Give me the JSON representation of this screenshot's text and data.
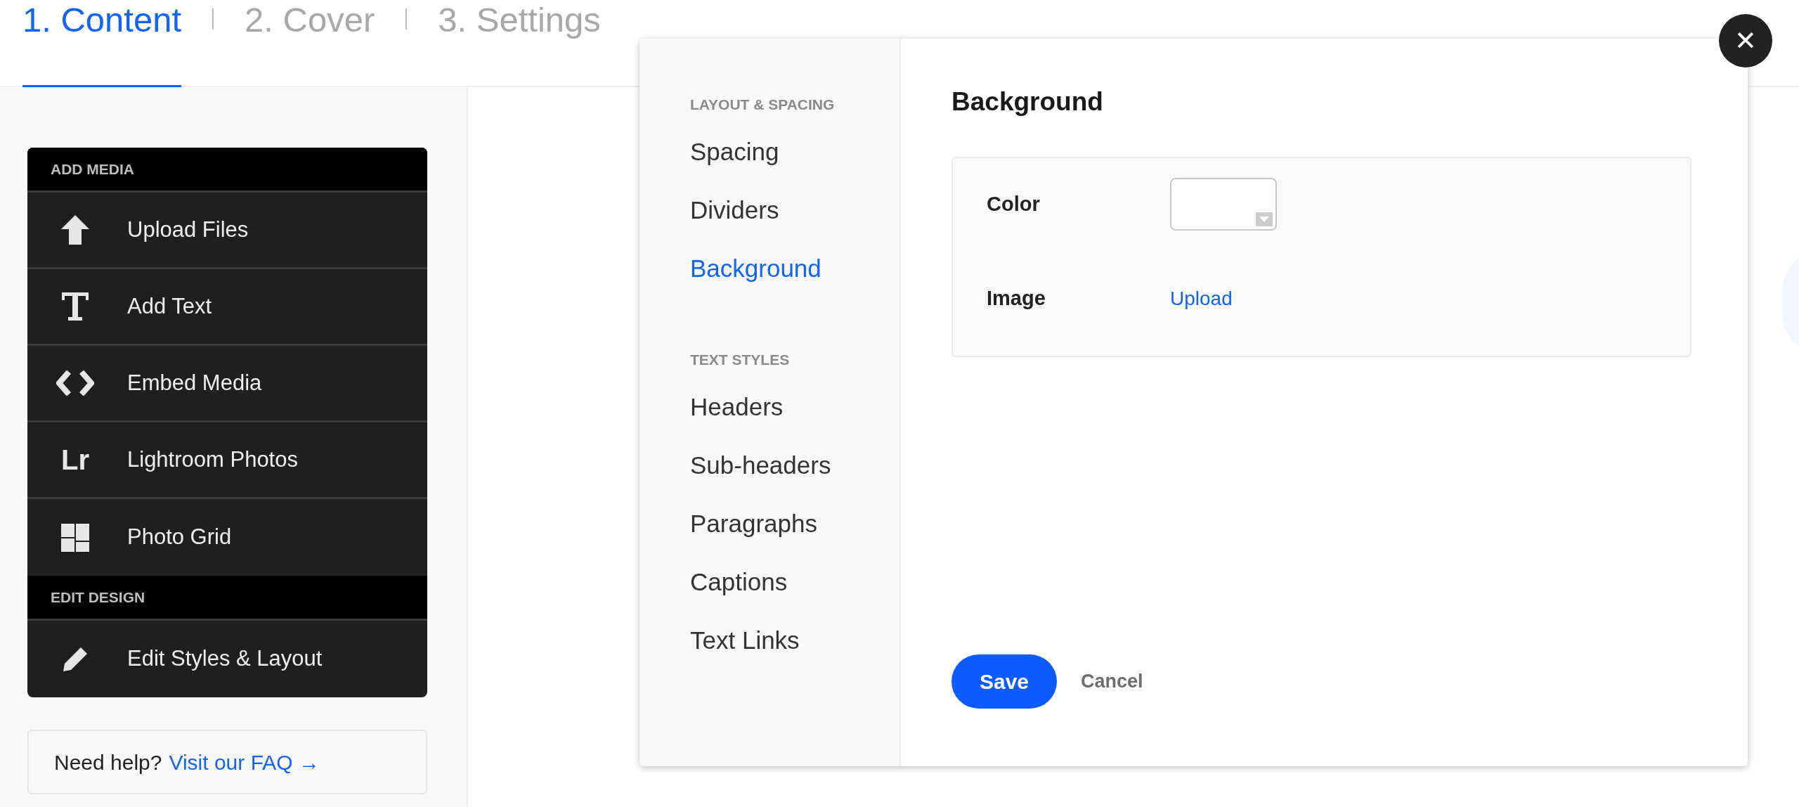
{
  "steps": [
    {
      "label": "1. Content",
      "selected": true
    },
    {
      "label": "2. Cover",
      "selected": false
    },
    {
      "label": "3. Settings",
      "selected": false
    }
  ],
  "sidebar": {
    "sections": [
      {
        "title": "ADD MEDIA",
        "items": [
          {
            "kind": "upload",
            "label": "Upload Files"
          },
          {
            "kind": "text",
            "label": "Add Text"
          },
          {
            "kind": "embed",
            "label": "Embed Media"
          },
          {
            "kind": "lightroom",
            "label": "Lightroom Photos",
            "icon_text": "Lr"
          },
          {
            "kind": "grid",
            "label": "Photo Grid"
          }
        ]
      },
      {
        "title": "EDIT DESIGN",
        "items": [
          {
            "kind": "pencil",
            "label": "Edit Styles & Layout"
          }
        ]
      }
    ],
    "help": {
      "text": "Need help?",
      "link": "Visit our FAQ →"
    }
  },
  "dialog": {
    "close_symbol": "✕",
    "nav": [
      {
        "title": "LAYOUT & SPACING",
        "items": [
          {
            "label": "Spacing",
            "selected": false
          },
          {
            "label": "Dividers",
            "selected": false
          },
          {
            "label": "Background",
            "selected": true
          }
        ]
      },
      {
        "title": "TEXT STYLES",
        "items": [
          {
            "label": "Headers",
            "selected": false
          },
          {
            "label": "Sub-headers",
            "selected": false
          },
          {
            "label": "Paragraphs",
            "selected": false
          },
          {
            "label": "Captions",
            "selected": false
          },
          {
            "label": "Text Links",
            "selected": false
          }
        ]
      }
    ],
    "heading": "Background",
    "fields": [
      {
        "kind": "color",
        "label": "Color"
      },
      {
        "kind": "link",
        "label": "Image",
        "value": "Upload"
      }
    ],
    "buttons": [
      {
        "kind": "primary",
        "label": "Save"
      },
      {
        "kind": "plain",
        "label": "Cancel"
      }
    ]
  }
}
